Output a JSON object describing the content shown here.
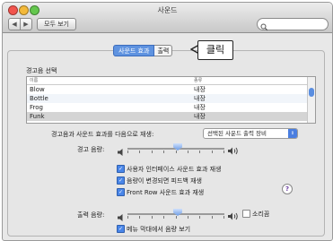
{
  "window": {
    "title": "사운드",
    "nav_back": "◀",
    "nav_forward": "▶",
    "show_all_label": "모두 보기",
    "search": {
      "placeholder": "",
      "value": ""
    }
  },
  "tabs": {
    "sound_effects": "사운드 효과",
    "output": "출력"
  },
  "callout": {
    "text": "클릭"
  },
  "alerts": {
    "heading": "경고음 선택",
    "columns": [
      "이름",
      "종류"
    ],
    "rows": [
      {
        "name": "Blow",
        "type": "내장"
      },
      {
        "name": "Bottle",
        "type": "내장"
      },
      {
        "name": "Frog",
        "type": "내장"
      },
      {
        "name": "Funk",
        "type": "내장"
      }
    ]
  },
  "play_through": {
    "label": "경고음과 사운드 효과를 다음으로 재생:",
    "value": "선택된 사운드 출력 장비"
  },
  "alert_volume": {
    "label": "경고 음량:",
    "level": 0.52
  },
  "options": [
    {
      "label": "사용자 인터페이스 사운드 효과 재생",
      "checked": true
    },
    {
      "label": "음량이 변경되면 피드백 재생",
      "checked": true
    },
    {
      "label": "Front Row 사운드 효과 재생",
      "checked": true
    }
  ],
  "help_label": "?",
  "output_volume": {
    "label": "출력 음량:",
    "level": 0.52,
    "mute_label": "소리끔",
    "mute_checked": false
  },
  "menu_bar_option": {
    "label": "메뉴 막대에서 음량 보기",
    "checked": true
  },
  "colors": {
    "accent": "#4a86e8",
    "selected_row": "#d4d4d4"
  }
}
